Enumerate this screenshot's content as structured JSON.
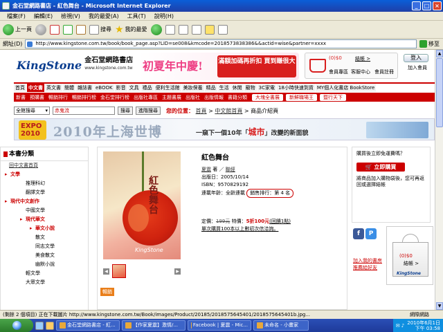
{
  "window": {
    "title": "金石堂網路書店 - 紅色舞台 - Microsoft Internet Explorer"
  },
  "menu": [
    "檔案(F)",
    "編輯(E)",
    "檢視(V)",
    "我的最愛(A)",
    "工具(T)",
    "說明(H)"
  ],
  "toolbar": {
    "back": "上一頁",
    "search": "搜尋",
    "favorites": "我的最愛"
  },
  "address": {
    "label": "網址(D)",
    "url": "http://www.kingstone.com.tw/book/book_page.asp?LID=se008&kmcode=2018573838386&&actid=wise&partner=xxxx",
    "go": "移至"
  },
  "site": {
    "logo": "KingStone",
    "logo_cn": "金石堂網路書店",
    "logo_url": "www.kingstone.com.tw",
    "promo_title": "初夏年中慶!",
    "promo_sub": "滿額加碼再折扣 買到賺很大",
    "cart": {
      "amount": "(0)$0",
      "checkout": "結帳 >",
      "member": "會員專區",
      "service": "客服中心",
      "register": "會員註冊"
    },
    "login": {
      "btn": "登入",
      "join": "加入會員"
    }
  },
  "nav": [
    "首頁",
    "中文書",
    "英文書",
    "簡體",
    "雜誌書",
    "eBOOK",
    "影音",
    "文具",
    "禮品",
    "便利生活館",
    "美妝保養",
    "精品",
    "生活",
    "休閒",
    "寵物",
    "3C家電",
    "18小時快速到貨",
    "MY個人化書店 BookStore"
  ],
  "nav_active": "中文書",
  "nav2": [
    "新書",
    "預購書",
    "暢銷排行",
    "暢銷排行榜",
    "金石堂排行榜",
    "出版社專區",
    "主題書展",
    "出版社",
    "出版情報",
    "書籍分類"
  ],
  "nav2_buttons": [
    "大塊全書展",
    "新鮮職場王",
    "暨行天下"
  ],
  "search": {
    "select": "全館搜尋",
    "input": "赤鬼流",
    "btn1": "搜尋",
    "btn2": "進階搜尋"
  },
  "crumb": {
    "label": "您的位置：",
    "home": "首頁",
    "sep1": ">",
    "cat": "中文館首頁",
    "sep2": ">",
    "cur": "商品介紹頁"
  },
  "expo": {
    "badge": "EXPO 2010",
    "title": "2010年上海世博",
    "tagline1": "一窺下一個10年「",
    "highlight": "城市",
    "tagline2": "」改變的新面貌"
  },
  "sidebar": {
    "title": "本書分類",
    "items": [
      {
        "label": "回中文書首頁",
        "level": "l0 under"
      },
      {
        "label": "文學",
        "level": "l1 red"
      },
      {
        "label": "推理科幻",
        "level": "l2"
      },
      {
        "label": "翻譯文學",
        "level": "l2"
      },
      {
        "label": "現代中文創作",
        "level": "l1 red"
      },
      {
        "label": "中國文學",
        "level": "l2"
      },
      {
        "label": "現代華文",
        "level": "l2 red"
      },
      {
        "label": "華文小說",
        "level": "l3 red"
      },
      {
        "label": "散文",
        "level": "l3"
      },
      {
        "label": "同志文學",
        "level": "l3"
      },
      {
        "label": "美食散文",
        "level": "l3"
      },
      {
        "label": "幽默小說",
        "level": "l3"
      },
      {
        "label": "輕文學",
        "level": "l2"
      },
      {
        "label": "大眾文學",
        "level": "l2"
      }
    ]
  },
  "product": {
    "title": "紅色舞台",
    "cover_title": "紅色舞台",
    "cover_pub": "KingStone",
    "author": "夏震",
    "author_suffix": "著",
    "sep": "／",
    "publisher": "聯經",
    "pubdate": "出版日：2005/10/14",
    "isbn": "ISBN：9570829192",
    "status": "連載年齡：全齡連載",
    "rank": "銷售排行：第 4 名",
    "price_label": "定價：",
    "price_orig": "199元",
    "special": "特價：",
    "discount": "5折",
    "price_now": "100元",
    "points": "(回饋1點)",
    "note": "單次購買100本以上數初次信洽詢。",
    "tag": "暢銷"
  },
  "buybox": {
    "question": "購買後立即免運費嗎？",
    "buy": "立即購買",
    "desc": "將商品加入購物袋後，您可再返回或選擇結帳"
  },
  "share": {
    "link1": "加入我的書房",
    "link2": "推薦給好友"
  },
  "popcart": {
    "amount": "(0)$0",
    "checkout": "結帳 >",
    "brand": "KingStone"
  },
  "status": {
    "text": "(剩餘 2 個項目) 正在下載圖片 http://www.kingstone.com.tw/Book/images/Product/20185/2018575645401/2018575645401b.jpg...",
    "zone": "網際網路"
  },
  "taskbar": {
    "start": "",
    "tasks": [
      "金石堂網路書店 - 紅...",
      "【作家夏震】激情/...",
      "Facebook | 夏震 - Mic...",
      "未命名 - 小畫家"
    ],
    "date": "2010年6月1日",
    "time": "下午 03:58"
  }
}
